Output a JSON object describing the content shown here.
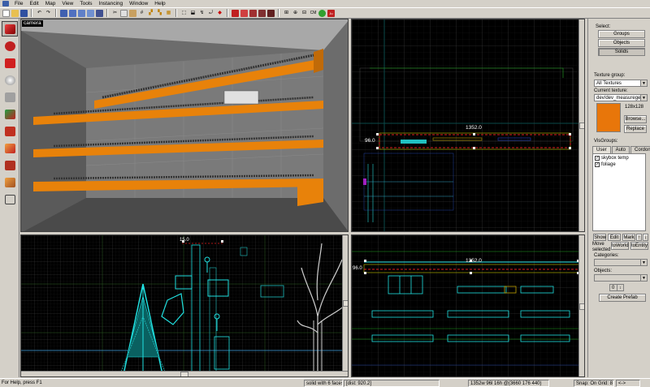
{
  "menu": [
    "File",
    "Edit",
    "Map",
    "View",
    "Tools",
    "Instancing",
    "Window",
    "Help"
  ],
  "viewports": {
    "camera_label": "camera",
    "top_dimension": "1352.0",
    "top_height": "96.0",
    "side_dimension": "15.0",
    "front_dimension": "1352.0",
    "front_height": "96.0"
  },
  "panel": {
    "select_label": "Select:",
    "groups_btn": "Groups",
    "objects_btn": "Objects",
    "solids_btn": "Solids",
    "texture_group_label": "Texture group:",
    "texture_group_value": "All Textures",
    "current_texture_label": "Current texture:",
    "current_texture_value": "dev/dev_measuregene",
    "texture_size": "128x128",
    "browse_btn": "Browse...",
    "replace_btn": "Replace",
    "visgroups_label": "VisGroups:",
    "tabs": [
      "User",
      "Auto",
      "Cordon"
    ],
    "visgroups": [
      "skybox temp",
      "foliage"
    ],
    "show_btn": "Show",
    "edit_btn": "Edit",
    "mark_btn": "Mark",
    "move_selected_label": "Move selected",
    "to_world_btn": "toWorld",
    "to_entity_btn": "toEntity",
    "categories_label": "Categories:",
    "objects_label": "Objects:",
    "spin_value": "0",
    "create_prefab_btn": "Create Prefab"
  },
  "status": {
    "help": "For Help, press F1",
    "selection": "solid with 6 faces",
    "dist": "[dist: 920.2]",
    "size": "1352w 96l 16h @(3660 176 440)",
    "snap": "Snap: On Grid: 8",
    "extra": "<->"
  }
}
